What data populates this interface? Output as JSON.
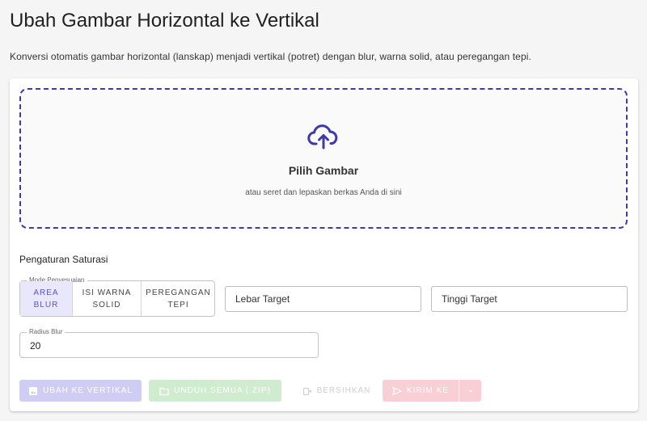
{
  "page": {
    "title": "Ubah Gambar Horizontal ke Vertikal",
    "description": "Konversi otomatis gambar horizontal (lanskap) menjadi vertikal (potret) dengan blur, warna solid, atau peregangan tepi."
  },
  "dropzone": {
    "icon": "cloud-upload-icon",
    "title": "Pilih Gambar",
    "subtitle": "atau seret dan lepaskan berkas Anda di sini"
  },
  "settings": {
    "title": "Pengaturan Saturasi",
    "mode_label": "Mode Penyesuaian",
    "modes": [
      {
        "line1": "AREA",
        "line2": "BLUR",
        "selected": true
      },
      {
        "line1": "ISI WARNA",
        "line2": "SOLID",
        "selected": false
      },
      {
        "line1": "PEREGANGAN",
        "line2": "TEPI",
        "selected": false
      }
    ],
    "target_width_placeholder": "Lebar Target",
    "target_height_placeholder": "Tinggi Target",
    "blur_radius_label": "Radius Blur",
    "blur_radius_value": "20"
  },
  "actions": {
    "convert_label": "UBAH KE VERTIKAL",
    "download_label": "UNDUH SEMUA (.ZIP)",
    "clear_label": "BERSIHKAN",
    "send_label": "KIRIM KE"
  },
  "colors": {
    "accent": "#3f3aa8",
    "convert_disabled": "#cfcdf3",
    "download_disabled": "#cfeccf",
    "send_disabled": "#f9cfd6"
  }
}
